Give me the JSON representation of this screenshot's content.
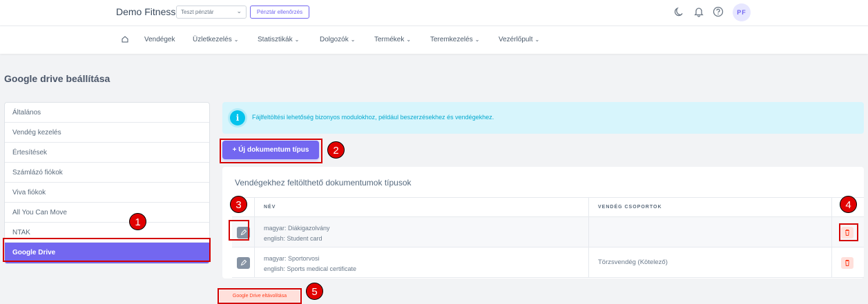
{
  "header": {
    "brand": "Demo Fitness",
    "cash_register_select": "Teszt pénztár",
    "cash_register_check": "Pénztár ellenőrzés",
    "avatar_initials": "PF"
  },
  "nav": {
    "items": [
      {
        "label": "Vendégek",
        "has_dropdown": false
      },
      {
        "label": "Üzletkezelés",
        "has_dropdown": true
      },
      {
        "label": "Statisztikák",
        "has_dropdown": true
      },
      {
        "label": "Dolgozók",
        "has_dropdown": true
      },
      {
        "label": "Termékek",
        "has_dropdown": true
      },
      {
        "label": "Teremkezelés",
        "has_dropdown": true
      },
      {
        "label": "Vezérlőpult",
        "has_dropdown": true
      }
    ]
  },
  "page": {
    "title": "Google drive beállítása"
  },
  "sidebar": {
    "items": [
      {
        "label": "Általános",
        "active": false
      },
      {
        "label": "Vendég kezelés",
        "active": false
      },
      {
        "label": "Értesítések",
        "active": false
      },
      {
        "label": "Számlázó fiókok",
        "active": false
      },
      {
        "label": "Viva fiókok",
        "active": false
      },
      {
        "label": "All You Can Move",
        "active": false
      },
      {
        "label": "NTAK",
        "active": false
      },
      {
        "label": "Google Drive",
        "active": true
      }
    ]
  },
  "alert": {
    "text": "Fájlfeltöltési lehetőség bizonyos modulokhoz, például beszerzésekhez és vendégekhez."
  },
  "new_doc_button": "Új dokumentum típus",
  "doc_types": {
    "title": "Vendégekhez feltölthető dokumentumok típusok",
    "columns": [
      "NÉV",
      "VENDÉG CSOPORTOK"
    ],
    "rows": [
      {
        "name_hu": "magyar: Diákigazolvány",
        "name_en": "english: Student card",
        "groups": ""
      },
      {
        "name_hu": "magyar: Sportorvosi",
        "name_en": "english: Sports medical certificate",
        "groups": "Törzsvendég (Kötelező)"
      }
    ]
  },
  "remove_button": "Google Drive eltávolítása",
  "annotations": [
    "1",
    "2",
    "3",
    "4",
    "5"
  ],
  "colors": {
    "primary": "#7367f0",
    "info": "#03c3ec",
    "danger": "#ff3e1d",
    "annotation": "#e00000"
  }
}
